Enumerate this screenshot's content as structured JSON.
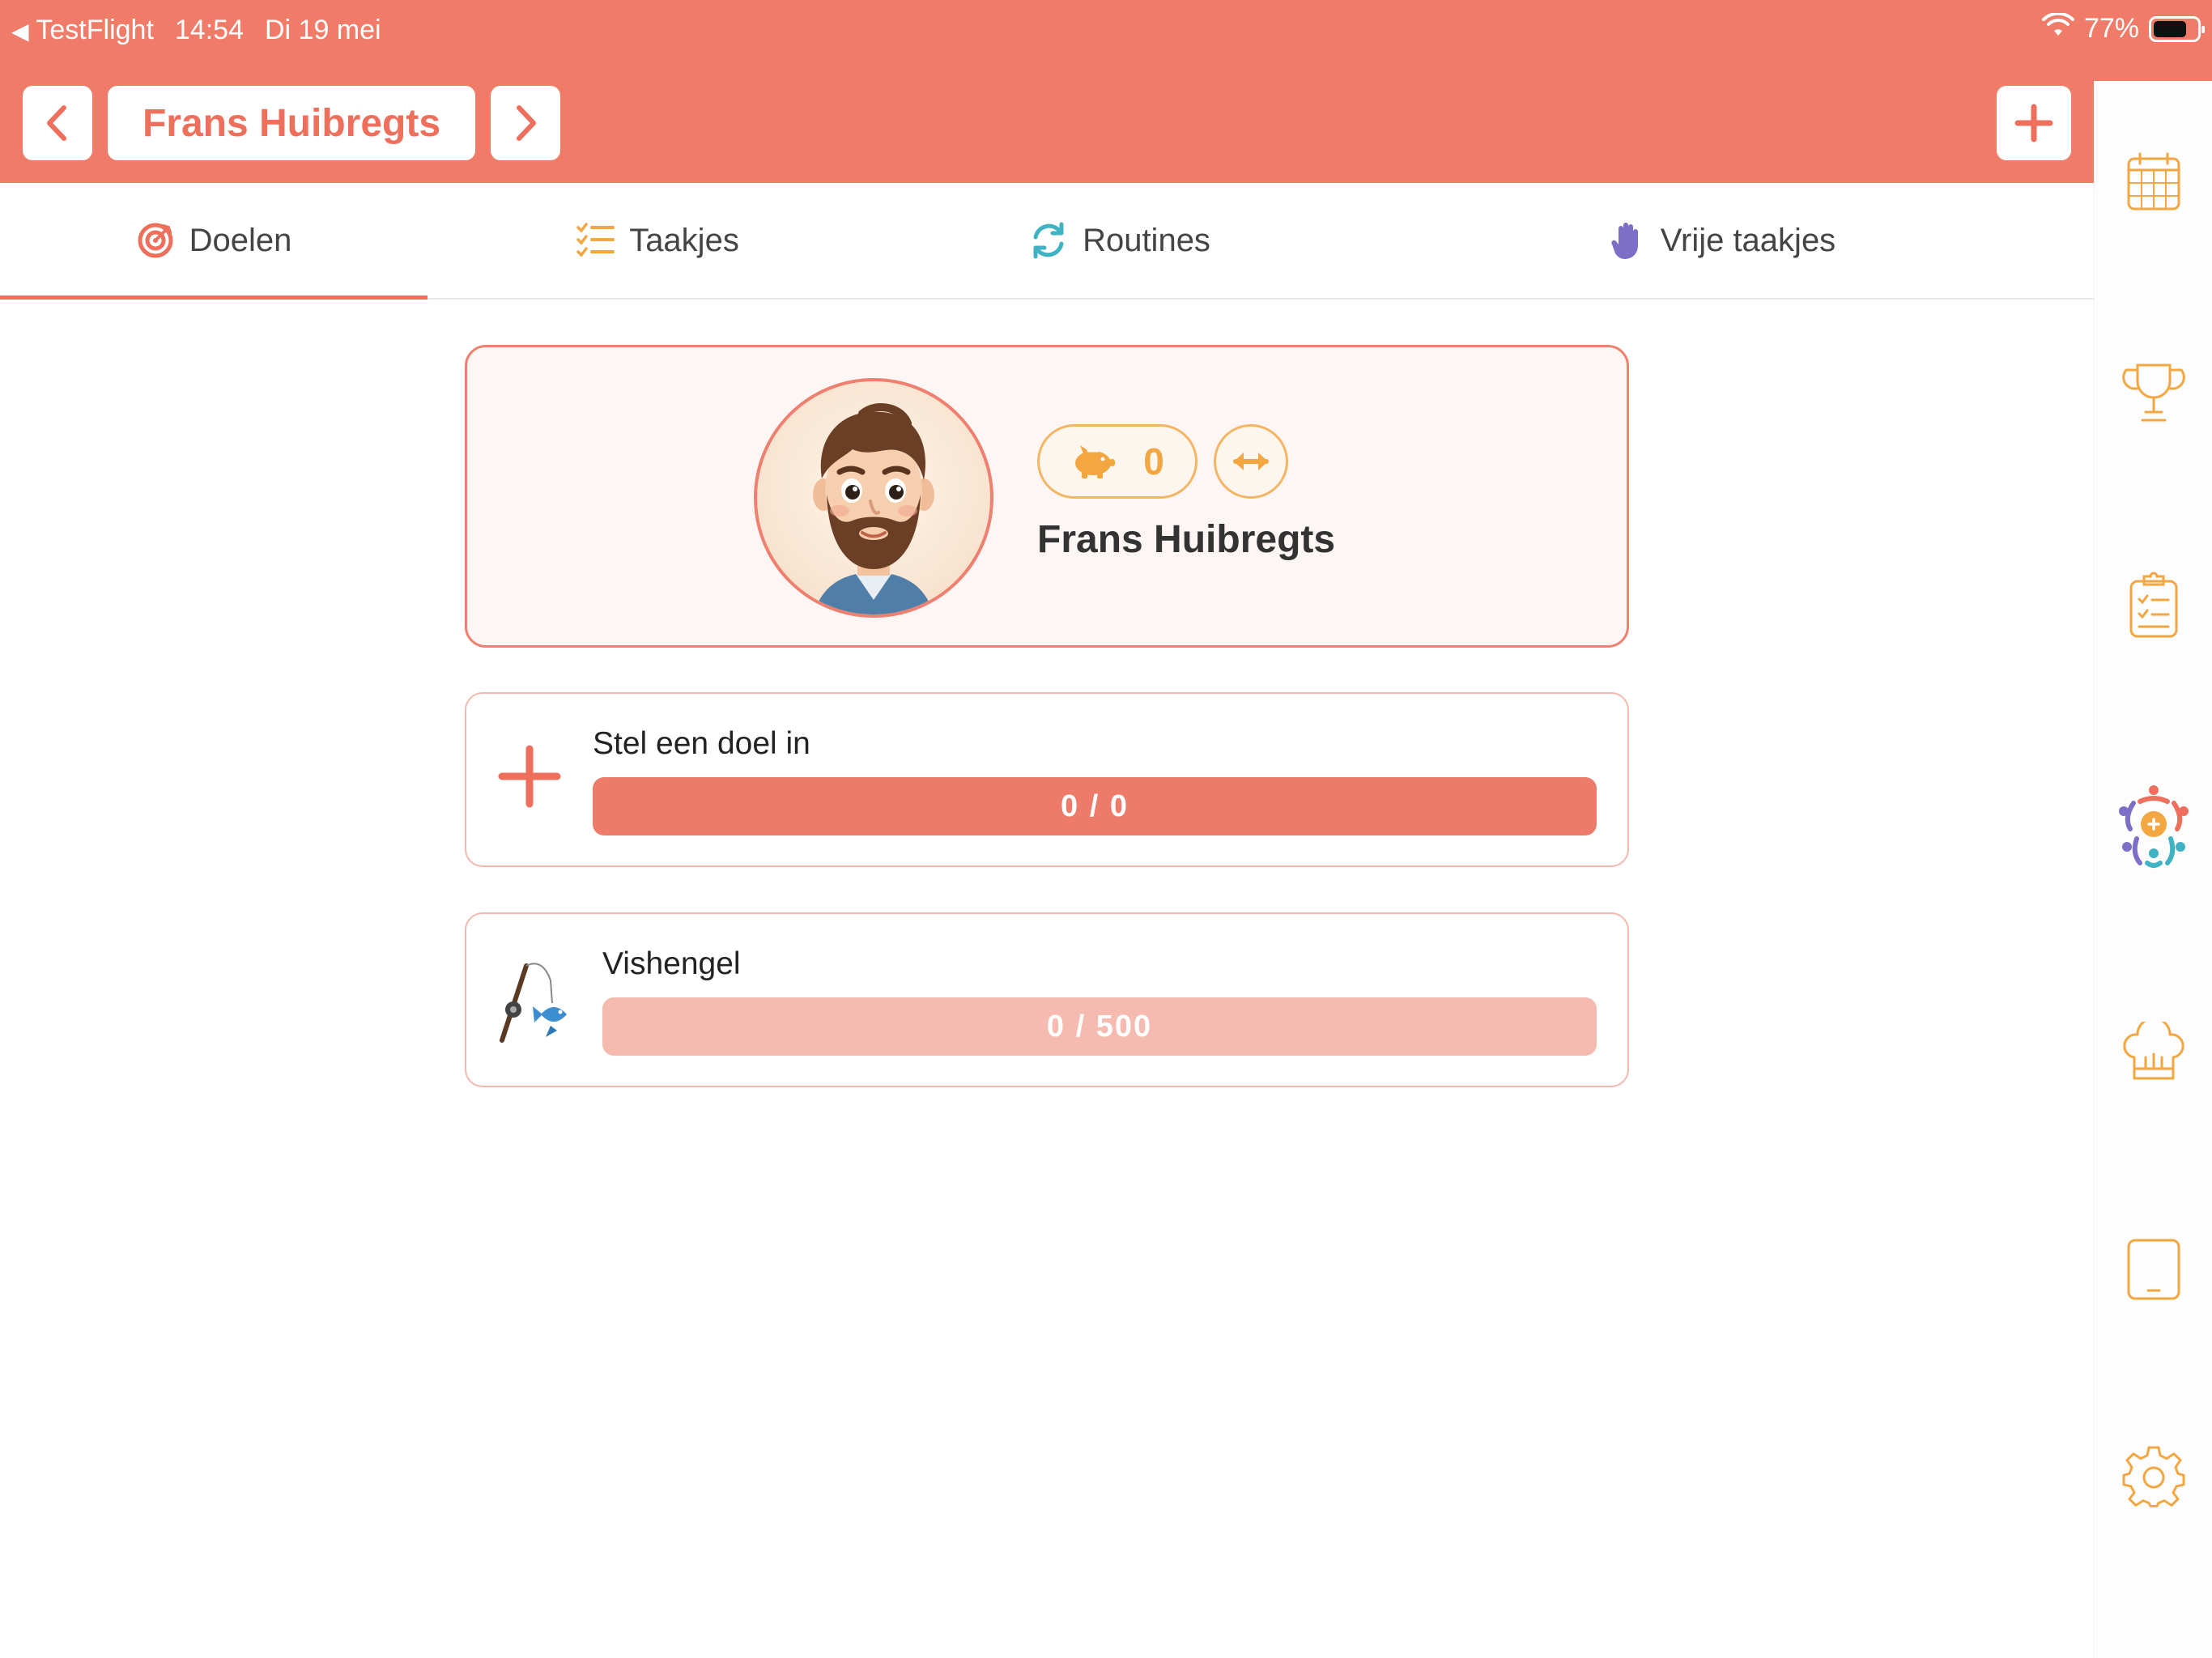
{
  "statusbar": {
    "back_app": "TestFlight",
    "time": "14:54",
    "date": "Di 19 mei",
    "battery": "77%"
  },
  "header": {
    "profile_name": "Frans Huibregts"
  },
  "tabs": [
    {
      "label": "Doelen",
      "icon": "target-icon",
      "active": true
    },
    {
      "label": "Taakjes",
      "icon": "checklist-icon",
      "active": false
    },
    {
      "label": "Routines",
      "icon": "refresh-icon",
      "active": false
    },
    {
      "label": "Vrije taakjes",
      "icon": "hand-icon",
      "active": false
    }
  ],
  "profile": {
    "name": "Frans Huibregts",
    "coins": "0"
  },
  "goals": [
    {
      "title": "Stel een doel in",
      "progress": "0 / 0",
      "progress_fraction": 1.0,
      "icon": "plus-icon"
    },
    {
      "title": "Vishengel",
      "progress": "0 / 500",
      "progress_fraction": 0.0,
      "icon": "fishing-rod-icon"
    }
  ],
  "sidebar": {
    "items": [
      "calendar-icon",
      "trophy-icon",
      "clipboard-icon",
      "family-logo-icon",
      "chef-hat-icon",
      "tablet-icon",
      "settings-icon"
    ]
  },
  "colors": {
    "accent": "#f07b69",
    "accent_light": "#f5bab0",
    "coin": "#f4a640",
    "routines_teal": "#3fb2c4",
    "hand_purple": "#7d6fc8"
  }
}
